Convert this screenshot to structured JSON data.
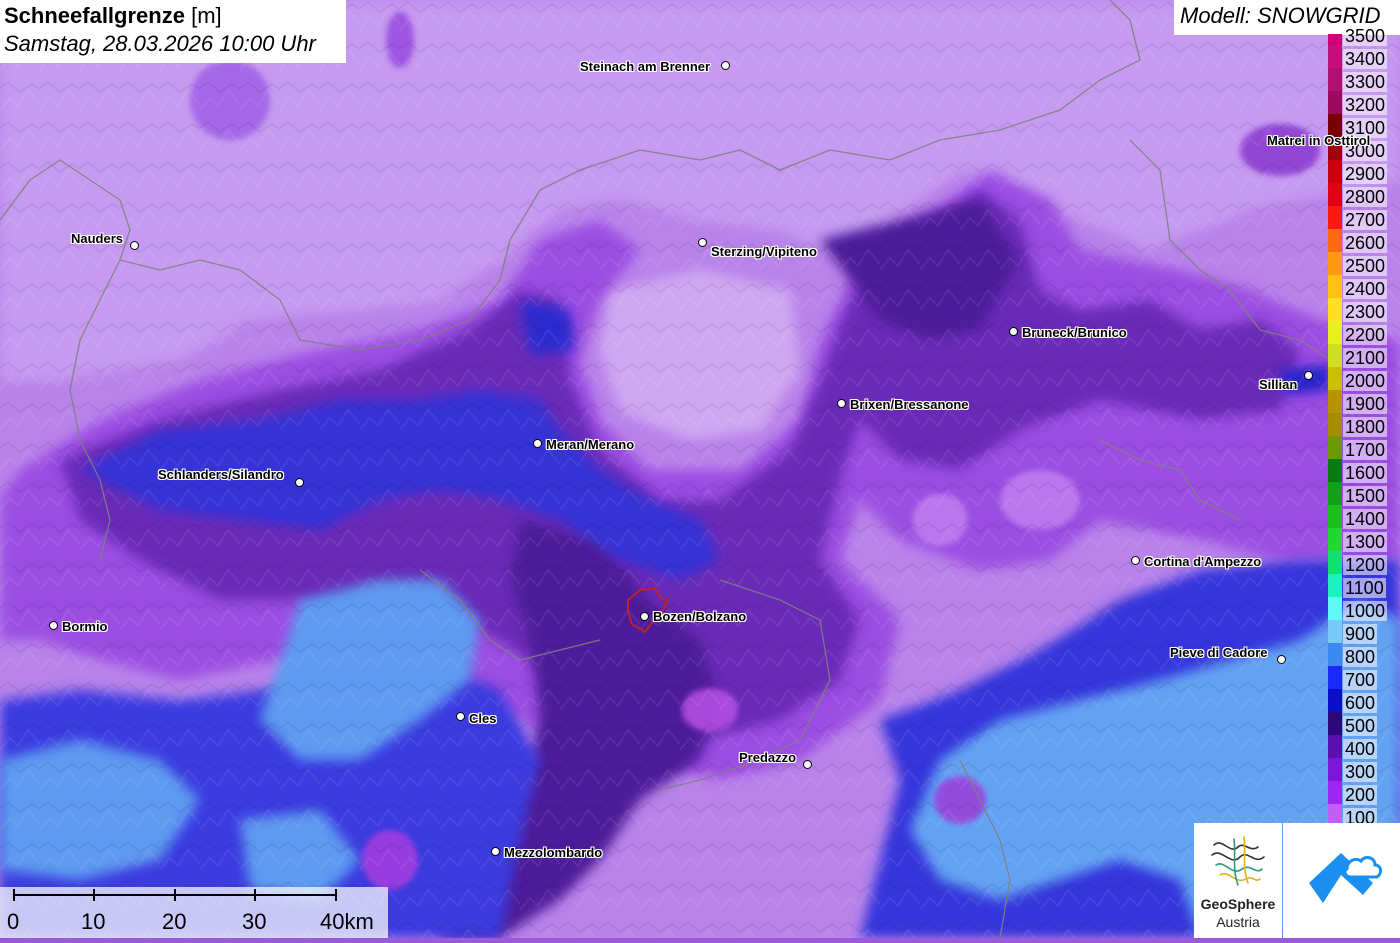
{
  "title": {
    "parameter": "Schneefallgrenze",
    "unit": "[m]",
    "datetime": "Samstag, 28.03.2026 10:00 Uhr"
  },
  "model": "Modell: SNOWGRID",
  "legend": {
    "entries": [
      {
        "label": "3500",
        "color": "#d0007a"
      },
      {
        "label": "3400",
        "color": "#c2107c"
      },
      {
        "label": "3300",
        "color": "#b01070"
      },
      {
        "label": "3200",
        "color": "#9a0a5e"
      },
      {
        "label": "3100",
        "color": "#7a0008"
      },
      {
        "label": "3000",
        "color": "#a00010"
      },
      {
        "label": "2900",
        "color": "#c80010"
      },
      {
        "label": "2800",
        "color": "#e00018"
      },
      {
        "label": "2700",
        "color": "#ff1a10"
      },
      {
        "label": "2600",
        "color": "#ff6a10"
      },
      {
        "label": "2500",
        "color": "#ff9a10"
      },
      {
        "label": "2400",
        "color": "#ffc010"
      },
      {
        "label": "2300",
        "color": "#ffe020"
      },
      {
        "label": "2200",
        "color": "#e8f020"
      },
      {
        "label": "2100",
        "color": "#d0e020"
      },
      {
        "label": "2000",
        "color": "#c8c000"
      },
      {
        "label": "1900",
        "color": "#b89400"
      },
      {
        "label": "1800",
        "color": "#a88c00"
      },
      {
        "label": "1700",
        "color": "#6c9a00"
      },
      {
        "label": "1600",
        "color": "#0a7a10"
      },
      {
        "label": "1500",
        "color": "#10a018"
      },
      {
        "label": "1400",
        "color": "#18c018"
      },
      {
        "label": "1300",
        "color": "#20d830"
      },
      {
        "label": "1200",
        "color": "#10e070"
      },
      {
        "label": "1100",
        "color": "#20f0c0"
      },
      {
        "label": "1000",
        "color": "#60f8f8"
      },
      {
        "label": "900",
        "color": "#78c8f8"
      },
      {
        "label": "800",
        "color": "#3a88f0"
      },
      {
        "label": "700",
        "color": "#1a2aff"
      },
      {
        "label": "600",
        "color": "#0a10c8"
      },
      {
        "label": "500",
        "color": "#2a0a78"
      },
      {
        "label": "400",
        "color": "#5a10b0"
      },
      {
        "label": "300",
        "color": "#7a18d8"
      },
      {
        "label": "200",
        "color": "#9a28f0"
      },
      {
        "label": "100",
        "color": "#c060f8"
      }
    ]
  },
  "cities": [
    {
      "name": "Steinach am Brenner"
    },
    {
      "name": "Nauders"
    },
    {
      "name": "Sterzing/Vipiteno"
    },
    {
      "name": "Matrei in Osttirol"
    },
    {
      "name": "Bruneck/Brunico"
    },
    {
      "name": "Sillian"
    },
    {
      "name": "Brixen/Bressanone"
    },
    {
      "name": "Meran/Merano"
    },
    {
      "name": "Schlanders/Silandro"
    },
    {
      "name": "Cortina d'Ampezzo"
    },
    {
      "name": "Bormio"
    },
    {
      "name": "Bozen/Bolzano"
    },
    {
      "name": "Pieve di Cadore"
    },
    {
      "name": "Cles"
    },
    {
      "name": "Predazzo"
    },
    {
      "name": "Mezzolombardo"
    }
  ],
  "scalebar": {
    "labels": [
      "0",
      "10",
      "20",
      "30",
      "40km"
    ]
  },
  "logos": {
    "geosphere_line1": "GeoSphere",
    "geosphere_line2": "Austria"
  },
  "colors": {
    "light_purple": "#b57ee8",
    "medium_purple": "#9848e0",
    "dark_purple": "#6428b0",
    "deep_violet": "#4a1f98",
    "blue": "#3030d8",
    "light_blue": "#5f9cf0",
    "border_line": "#777777"
  }
}
